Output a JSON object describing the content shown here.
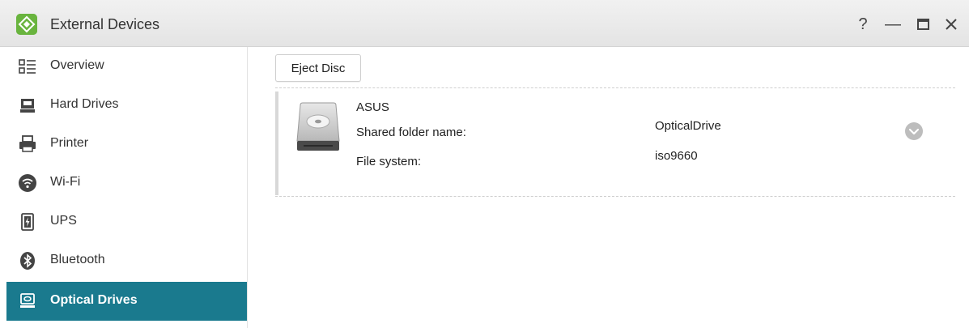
{
  "window": {
    "title": "External Devices",
    "help_glyph": "?",
    "minimize_glyph": "—"
  },
  "sidebar": {
    "items": [
      {
        "label": "Overview",
        "icon": "list-icon"
      },
      {
        "label": "Hard Drives",
        "icon": "hard-drive-icon"
      },
      {
        "label": "Printer",
        "icon": "printer-icon"
      },
      {
        "label": "Wi-Fi",
        "icon": "wifi-icon"
      },
      {
        "label": "UPS",
        "icon": "battery-icon"
      },
      {
        "label": "Bluetooth",
        "icon": "bluetooth-icon"
      },
      {
        "label": "Optical Drives",
        "icon": "optical-drive-icon",
        "active": true
      }
    ]
  },
  "main": {
    "eject_label": "Eject Disc",
    "drive": {
      "name": "ASUS",
      "shared_folder_label": "Shared folder name:",
      "shared_folder_value": "OpticalDrive",
      "file_system_label": "File system:",
      "file_system_value": "iso9660"
    }
  },
  "colors": {
    "accent": "#1a7a8e",
    "logo": "#69b43e"
  }
}
